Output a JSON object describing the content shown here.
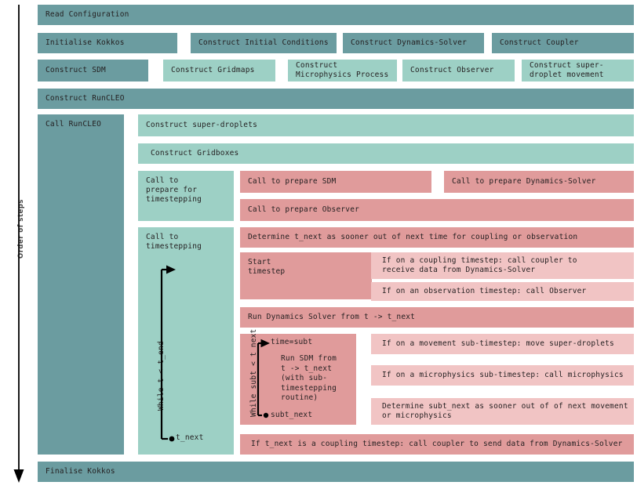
{
  "meta": {
    "colors": {
      "teal_dark": "#6b9ca0",
      "teal_light": "#9dd0c5",
      "pink_dark": "#e09b9b",
      "pink_light": "#f1c4c4",
      "arrow": "#000000",
      "background": "#ffffff"
    }
  },
  "axis": {
    "order_label": "Order of steps"
  },
  "rows": {
    "read_configuration": "Read Configuration",
    "construct_runcleo": "Construct RunCLEO",
    "finalise_kokkos": "Finalise Kokkos"
  },
  "setup_row": {
    "initialise_kokkos": "Initialise Kokkos",
    "construct_initial_conditions": "Construct Initial Conditions",
    "construct_dynamics_solver": "Construct Dynamics-Solver",
    "construct_coupler": "Construct Coupler"
  },
  "construct_row": {
    "construct_sdm": "Construct SDM",
    "construct_gridmaps": "Construct Gridmaps",
    "construct_microphysics_process": "Construct\nMicrophysics Process",
    "construct_observer": "Construct Observer",
    "construct_superdroplet_movement": "Construct super-\ndroplet movement"
  },
  "runcleo": {
    "call_runcleo": "Call RunCLEO",
    "construct_super_droplets": "Construct super-droplets",
    "construct_gridboxes": "Construct Gridboxes",
    "call_to_prepare_for_timestepping": "Call to\nprepare for\ntimestepping",
    "call_to_timestepping": "Call to\ntimestepping"
  },
  "prepare": {
    "prepare_sdm": "Call to prepare SDM",
    "prepare_dynamics_solver": "Call to prepare Dynamics-Solver",
    "prepare_observer": "Call to prepare Observer"
  },
  "timestepping": {
    "determine_t_next": "Determine t_next as sooner out of next time for coupling or observation",
    "start_timestep": "Start\ntimestep",
    "coupling_receive": "If on a coupling timestep: call coupler to\nreceive data from Dynamics-Solver",
    "observation_observer": "If on an observation timestep: call Observer",
    "run_dynamics_solver": "Run Dynamics Solver from t -> t_next",
    "while_t_end_label": "While t < t_end",
    "t_next_label": "t_next",
    "coupling_send": "If t_next is a coupling timestep: call coupler to send data from Dynamics-Solver"
  },
  "substepping": {
    "while_subt_label": "While subt < t_next",
    "time_eq_subt": "time=subt",
    "run_sdm": "Run SDM from\nt -> t_next\n(with sub-\ntimestepping\nroutine)",
    "subt_next": "subt_next",
    "movement_substep": "If on a movement sub-timestep: move super-droplets",
    "microphysics_substep": "If on a microphysics sub-timestep: call microphysics",
    "determine_subt_next": "Determine subt_next as sooner out of of next movement\nor microphysics"
  }
}
